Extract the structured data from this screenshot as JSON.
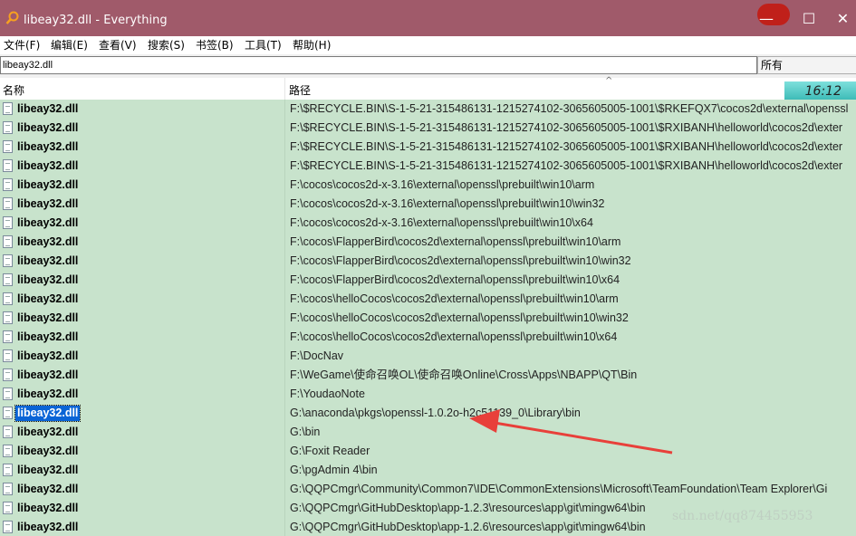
{
  "window": {
    "title": "libeay32.dll - Everything",
    "minimize": "—",
    "maximize": "☐",
    "close": "✕"
  },
  "menu": [
    "文件(F)",
    "编辑(E)",
    "查看(V)",
    "搜索(S)",
    "书签(B)",
    "工具(T)",
    "帮助(H)"
  ],
  "search": {
    "value": "libeay32.dll",
    "filter": "所有"
  },
  "columns": {
    "name": "名称",
    "path": "路径"
  },
  "clock": "16:12",
  "colors": {
    "titlebar": "#a05a6a",
    "row_bg": "#c8e3cc",
    "selection": "#0a64d6",
    "arrow": "#e8403a"
  },
  "rows": [
    {
      "name": "libeay32.dll",
      "path": "F:\\$RECYCLE.BIN\\S-1-5-21-315486131-1215274102-3065605005-1001\\$RKEFQX7\\cocos2d\\external\\openssl"
    },
    {
      "name": "libeay32.dll",
      "path": "F:\\$RECYCLE.BIN\\S-1-5-21-315486131-1215274102-3065605005-1001\\$RXIBANH\\helloworld\\cocos2d\\exter"
    },
    {
      "name": "libeay32.dll",
      "path": "F:\\$RECYCLE.BIN\\S-1-5-21-315486131-1215274102-3065605005-1001\\$RXIBANH\\helloworld\\cocos2d\\exter"
    },
    {
      "name": "libeay32.dll",
      "path": "F:\\$RECYCLE.BIN\\S-1-5-21-315486131-1215274102-3065605005-1001\\$RXIBANH\\helloworld\\cocos2d\\exter"
    },
    {
      "name": "libeay32.dll",
      "path": "F:\\cocos\\cocos2d-x-3.16\\external\\openssl\\prebuilt\\win10\\arm"
    },
    {
      "name": "libeay32.dll",
      "path": "F:\\cocos\\cocos2d-x-3.16\\external\\openssl\\prebuilt\\win10\\win32"
    },
    {
      "name": "libeay32.dll",
      "path": "F:\\cocos\\cocos2d-x-3.16\\external\\openssl\\prebuilt\\win10\\x64"
    },
    {
      "name": "libeay32.dll",
      "path": "F:\\cocos\\FlapperBird\\cocos2d\\external\\openssl\\prebuilt\\win10\\arm"
    },
    {
      "name": "libeay32.dll",
      "path": "F:\\cocos\\FlapperBird\\cocos2d\\external\\openssl\\prebuilt\\win10\\win32"
    },
    {
      "name": "libeay32.dll",
      "path": "F:\\cocos\\FlapperBird\\cocos2d\\external\\openssl\\prebuilt\\win10\\x64"
    },
    {
      "name": "libeay32.dll",
      "path": "F:\\cocos\\helloCocos\\cocos2d\\external\\openssl\\prebuilt\\win10\\arm"
    },
    {
      "name": "libeay32.dll",
      "path": "F:\\cocos\\helloCocos\\cocos2d\\external\\openssl\\prebuilt\\win10\\win32"
    },
    {
      "name": "libeay32.dll",
      "path": "F:\\cocos\\helloCocos\\cocos2d\\external\\openssl\\prebuilt\\win10\\x64"
    },
    {
      "name": "libeay32.dll",
      "path": "F:\\DocNav"
    },
    {
      "name": "libeay32.dll",
      "path": "F:\\WeGame\\使命召唤OL\\使命召唤Online\\Cross\\Apps\\NBAPP\\QT\\Bin"
    },
    {
      "name": "libeay32.dll",
      "path": "F:\\YoudaoNote"
    },
    {
      "name": "libeay32.dll",
      "path": "G:\\anaconda\\pkgs\\openssl-1.0.2o-h2c51139_0\\Library\\bin",
      "selected": true
    },
    {
      "name": "libeay32.dll",
      "path": "G:\\bin"
    },
    {
      "name": "libeay32.dll",
      "path": "G:\\Foxit Reader"
    },
    {
      "name": "libeay32.dll",
      "path": "G:\\pgAdmin 4\\bin"
    },
    {
      "name": "libeay32.dll",
      "path": "G:\\QQPCmgr\\Community\\Common7\\IDE\\CommonExtensions\\Microsoft\\TeamFoundation\\Team Explorer\\Gi"
    },
    {
      "name": "libeay32.dll",
      "path": "G:\\QQPCmgr\\GitHubDesktop\\app-1.2.3\\resources\\app\\git\\mingw64\\bin"
    },
    {
      "name": "libeay32.dll",
      "path": "G:\\QQPCmgr\\GitHubDesktop\\app-1.2.6\\resources\\app\\git\\mingw64\\bin"
    }
  ],
  "watermark": "sdn.net/qq874455953"
}
